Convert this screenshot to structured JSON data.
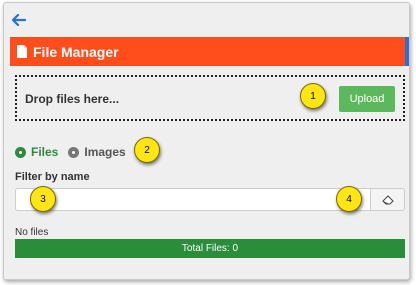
{
  "header": {
    "title": "File Manager"
  },
  "dropzone": {
    "text": "Drop files here...",
    "upload_label": "Upload"
  },
  "tabs": [
    {
      "label": "Files",
      "active": true
    },
    {
      "label": "Images",
      "active": false
    }
  ],
  "filter": {
    "label": "Filter by name",
    "value": "",
    "placeholder": ""
  },
  "status": {
    "empty_text": "No files",
    "total_label": "Total Files: 0"
  },
  "callouts": [
    "1",
    "2",
    "3",
    "4"
  ],
  "colors": {
    "header": "#ff4e1c",
    "upload": "#5cb85c",
    "active_tab": "#2f8a3c",
    "total_bar": "#2a8d3a",
    "callout": "#ffe512"
  },
  "icons": {
    "back": "arrow-left-icon",
    "file": "file-icon",
    "clear": "eraser-icon"
  }
}
